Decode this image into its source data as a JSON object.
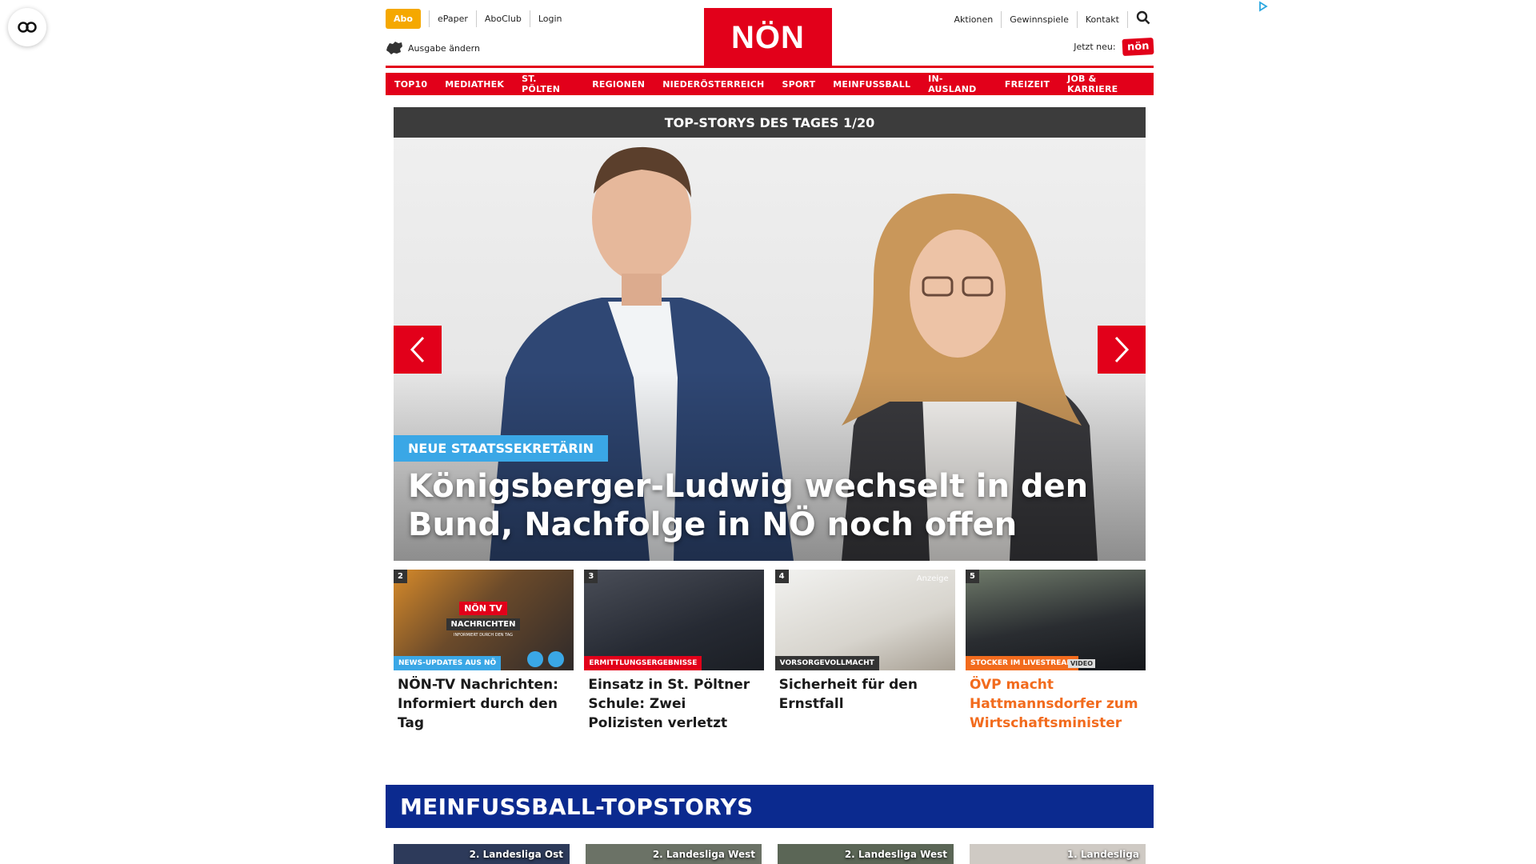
{
  "header": {
    "abo_label": "Abo",
    "links_left": [
      "ePaper",
      "AboClub",
      "Login"
    ],
    "ausgabe_label": "Ausgabe ändern",
    "logo_text": "NÖN",
    "links_right": [
      "Aktionen",
      "Gewinnspiele",
      "Kontakt"
    ],
    "jetzt_neu_label": "Jetzt neu:",
    "jetzt_neu_logo": "nön"
  },
  "nav": {
    "items": [
      "TOP10",
      "MEDIATHEK",
      "ST. PÖLTEN",
      "REGIONEN",
      "NIEDERÖSTERREICH",
      "SPORT",
      "MEINFUSSBALL",
      "IN-AUSLAND",
      "FREIZEIT",
      "JOB & KARRIERE"
    ]
  },
  "slider": {
    "heading": "TOP-STORYS DES TAGES 1/20",
    "kicker": "NEUE STAATSSEKRETÄRIN",
    "title": "Königsberger-Ludwig wechselt in den Bund, Nachfolge in NÖ noch offen"
  },
  "cards": [
    {
      "num": "2",
      "category": "NEWS-UPDATES AUS NÖ",
      "title": "NÖN-TV Nachrichten: Informiert durch den Tag",
      "cat_color": "#3aa7e6",
      "overlay_brand": "NÖN TV",
      "overlay_title": "NACHRICHTEN",
      "overlay_sub": "INFORMIERT DURCH DEN TAG"
    },
    {
      "num": "3",
      "category": "ERMITTLUNGSERGEBNISSE",
      "title": "Einsatz in St. Pöltner Schule: Zwei Polizisten verletzt",
      "cat_color": "#e2001a"
    },
    {
      "num": "4",
      "category": "VORSORGEVOLLMACHT",
      "title": "Sicherheit für den Ernstfall",
      "cat_color": "#333333",
      "ad_label": "Anzeige"
    },
    {
      "num": "5",
      "category": "STOCKER IM LIVESTREAM",
      "title": "ÖVP macht Hattmannsdorfer zum Wirtschaftsminister",
      "cat_color": "#f26b1d",
      "badge": "VIDEO"
    }
  ],
  "section": {
    "title": "MEINFUSSBALL-TOPSTORYS",
    "items": [
      "2. Landesliga Ost",
      "2. Landesliga West",
      "2. Landesliga West",
      "1. Landesliga"
    ]
  }
}
